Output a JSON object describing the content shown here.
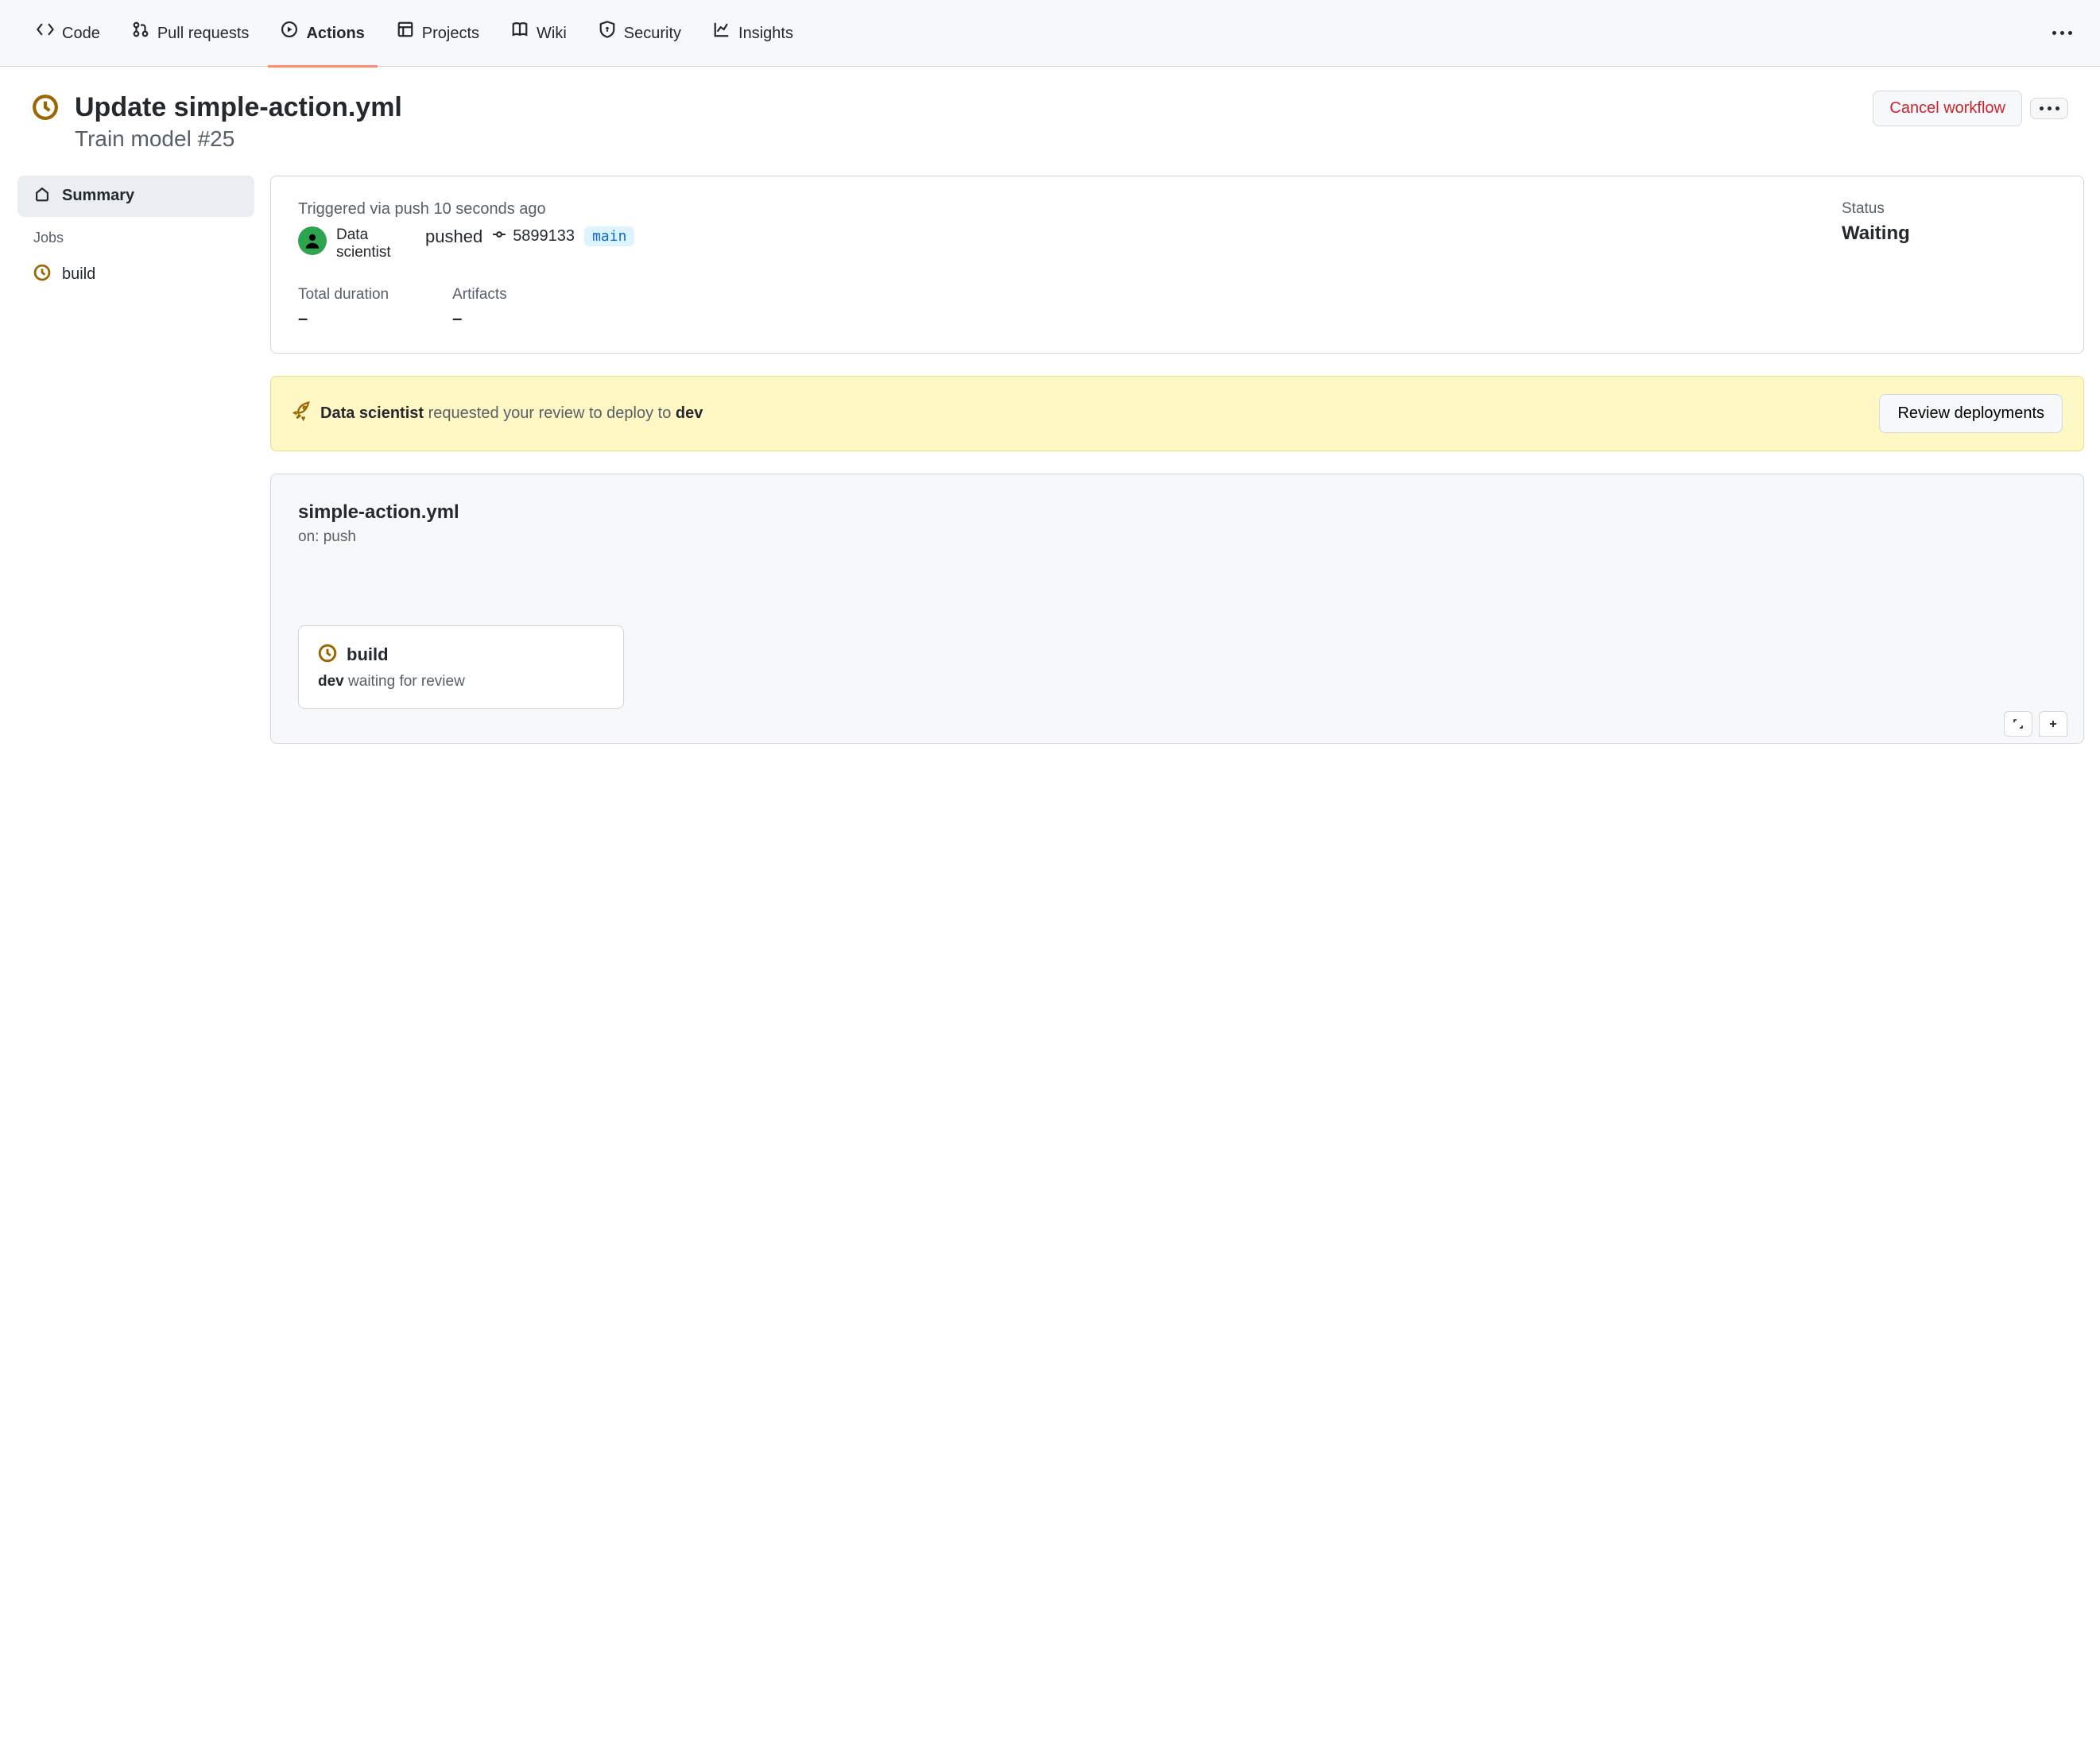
{
  "nav": {
    "tabs": [
      {
        "id": "code",
        "label": "Code",
        "icon": "code"
      },
      {
        "id": "pulls",
        "label": "Pull requests",
        "icon": "git-pull-request"
      },
      {
        "id": "actions",
        "label": "Actions",
        "icon": "play-circle",
        "active": true
      },
      {
        "id": "projects",
        "label": "Projects",
        "icon": "table"
      },
      {
        "id": "wiki",
        "label": "Wiki",
        "icon": "book"
      },
      {
        "id": "security",
        "label": "Security",
        "icon": "shield"
      },
      {
        "id": "insights",
        "label": "Insights",
        "icon": "graph"
      }
    ]
  },
  "header": {
    "title": "Update simple-action.yml",
    "subtitle": "Train model #25",
    "cancel_label": "Cancel workflow"
  },
  "sidebar": {
    "summary_label": "Summary",
    "jobs_heading": "Jobs",
    "jobs": [
      {
        "name": "build"
      }
    ]
  },
  "run": {
    "trigger_text": "Triggered via push 10 seconds ago",
    "actor": "Data scientist",
    "verb": "pushed",
    "commit_sha": "5899133",
    "branch": "main",
    "status_label": "Status",
    "status_value": "Waiting",
    "duration_label": "Total duration",
    "duration_value": "–",
    "artifacts_label": "Artifacts",
    "artifacts_value": "–"
  },
  "review_banner": {
    "actor": "Data scientist",
    "middle": " requested your review to deploy to ",
    "env": "dev",
    "button": "Review deployments"
  },
  "workflow": {
    "file": "simple-action.yml",
    "on_label": "on: push",
    "job": {
      "name": "build",
      "env_bold": "dev",
      "wait_text": " waiting for review"
    }
  }
}
